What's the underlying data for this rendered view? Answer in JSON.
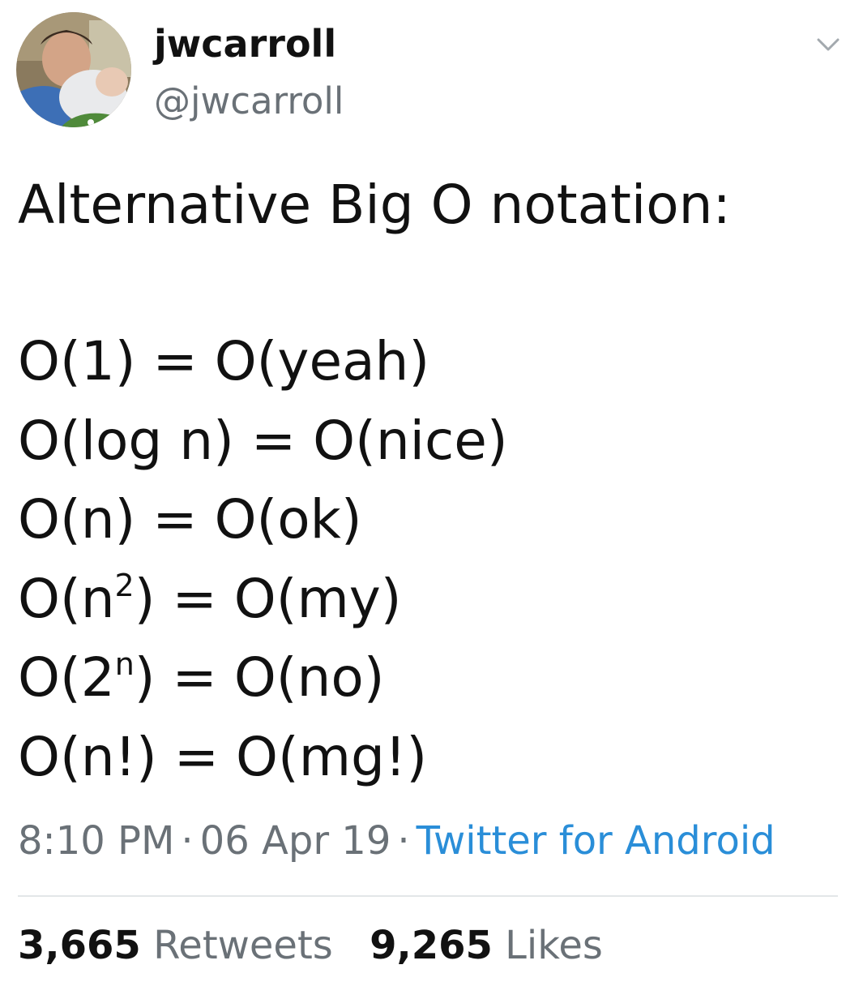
{
  "author": {
    "display_name": "jwcarroll",
    "handle": "@jwcarroll"
  },
  "tweet": {
    "headline": "Alternative Big O notation:",
    "rows": [
      {
        "left": "O(1)",
        "right": "O(yeah)"
      },
      {
        "left": "O(log n)",
        "right": "O(nice)"
      },
      {
        "left_base": "O(n",
        "left_sup": "2",
        "left_end": ")",
        "right": "O(my)"
      },
      {
        "left_base": "O(2",
        "left_sup": "n",
        "left_end": ")",
        "right": "O(no)"
      },
      {
        "left": "O(n!)",
        "right": "O(mg!)"
      }
    ],
    "row_ok": {
      "left": "O(n)",
      "right": "O(ok)"
    },
    "equals": "="
  },
  "meta": {
    "time": "8:10 PM",
    "date": "06 Apr 19",
    "separator": "·",
    "source": "Twitter for Android"
  },
  "stats": {
    "retweets_count": "3,665",
    "retweets_label": "Retweets",
    "likes_count": "9,265",
    "likes_label": "Likes"
  },
  "colors": {
    "text": "#111111",
    "secondary": "#6a7177",
    "link": "#2a8ed8",
    "divider": "#e3e6e8"
  },
  "icons": {
    "menu": "chevron-down-icon"
  }
}
